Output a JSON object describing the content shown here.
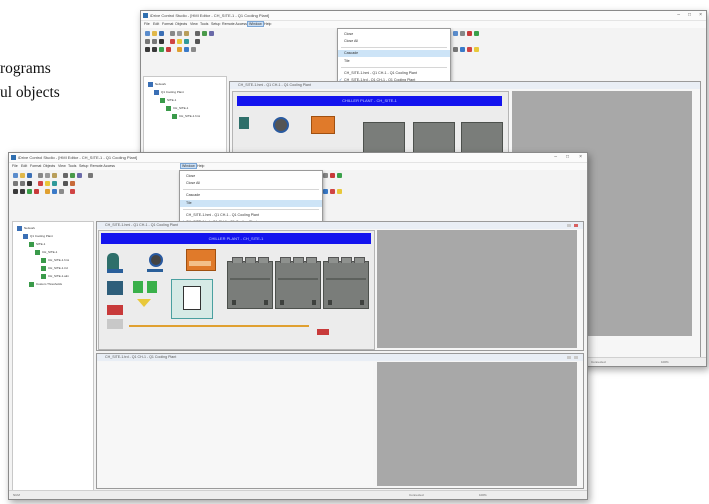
{
  "document": {
    "line1": "rograms",
    "line2": "ul objects"
  },
  "app": {
    "title": "iDrive Control Studio - [HMI Editor - CH_SITE-1 - Q1 Cooling Plant]",
    "menus": [
      "File",
      "Edit",
      "Format",
      "Objects",
      "View",
      "Tools",
      "Setup",
      "Remote Access",
      "Window",
      "Help"
    ],
    "active_menu": "Window",
    "window_menu_items": [
      "Close",
      "Close All",
      "Cascade",
      "Tile",
      "CH_SITE-1.hmi - Q1 CH-1 - Q1 Cooling Plant",
      "CH_SITE-1.trd - Q1 CH-1 - Q1 Cooling Plant"
    ],
    "back_highlight_index": 2,
    "front_highlight_index": 3,
    "accent": "#1414ee",
    "menu_highlight": "#cde4f7"
  },
  "tree": {
    "items": [
      "Network",
      "Q1 Cooling Plant",
      "SITE-1",
      "CH_SITE-1",
      "CH_SITE-1.hmi",
      "CH_SITE-1.trd",
      "CH_SITE-1.alm",
      "Custom Thresholds"
    ]
  },
  "hmi": {
    "subwindow_title": "CH_SITE-1.hmi - Q1 CH-1 - Q1 Cooling Plant",
    "header_text": "CHILLER PLANT - CH_SITE-1",
    "towers": [
      "CT-1",
      "CT-2",
      "CT-3"
    ]
  },
  "trend": {
    "subwindow_title": "CH_SITE-1.trd - Q1 CH-1 - Q1 Cooling Plant"
  },
  "status": {
    "left": "NUM",
    "right_a": "Connected",
    "right_b": "100%"
  },
  "icons": [
    "app-icon",
    "minimize-icon",
    "maximize-icon",
    "close-icon",
    "folder-icon",
    "device-icon",
    "pump-icon",
    "fan-icon",
    "checkmark-icon"
  ]
}
